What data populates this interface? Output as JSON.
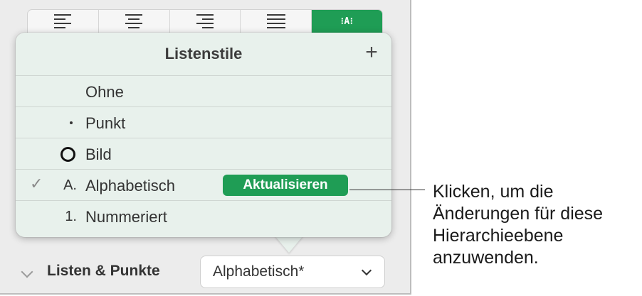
{
  "toolbar": {
    "alignment_buttons": [
      "align-left",
      "align-center",
      "align-right",
      "align-justify",
      "list-style"
    ],
    "selected": "list-style"
  },
  "popover": {
    "title": "Listenstile",
    "add_button": "+",
    "items": [
      {
        "marker": "",
        "label": "Ohne"
      },
      {
        "marker": "•",
        "label": "Punkt"
      },
      {
        "marker": "circle-icon",
        "label": "Bild"
      },
      {
        "marker": "A.",
        "label": "Alphabetisch",
        "checked": "✓",
        "update_button": "Aktualisieren"
      },
      {
        "marker": "1.",
        "label": "Nummeriert"
      }
    ]
  },
  "footer": {
    "section_label": "Listen & Punkte",
    "select_value": "Alphabetisch*"
  },
  "callout": {
    "text": "Klicken, um die Änderungen für diese Hierarchieebene anzuwenden."
  },
  "colors": {
    "accent": "#1f9d55",
    "popover_bg": "#e8f1ec",
    "panel_bg": "#ececec"
  }
}
